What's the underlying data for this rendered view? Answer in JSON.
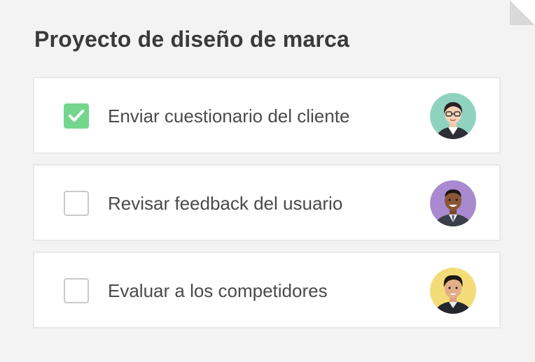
{
  "project": {
    "title": "Proyecto de diseño de marca"
  },
  "tasks": [
    {
      "label": "Enviar cuestionario del cliente",
      "checked": true,
      "avatar": "woman-with-glasses-avatar",
      "avatar_bg": "#8fd3bf"
    },
    {
      "label": "Revisar feedback del usuario",
      "checked": false,
      "avatar": "smiling-man-avatar",
      "avatar_bg": "#a98ad0"
    },
    {
      "label": "Evaluar a los competidores",
      "checked": false,
      "avatar": "man-with-dark-hair-avatar",
      "avatar_bg": "#f3dc78"
    }
  ],
  "colors": {
    "checked": "#74d68d",
    "text": "#4a4a4a",
    "title": "#3a3a3a",
    "background": "#f3f3f3",
    "card_border": "#e8e8e8"
  }
}
